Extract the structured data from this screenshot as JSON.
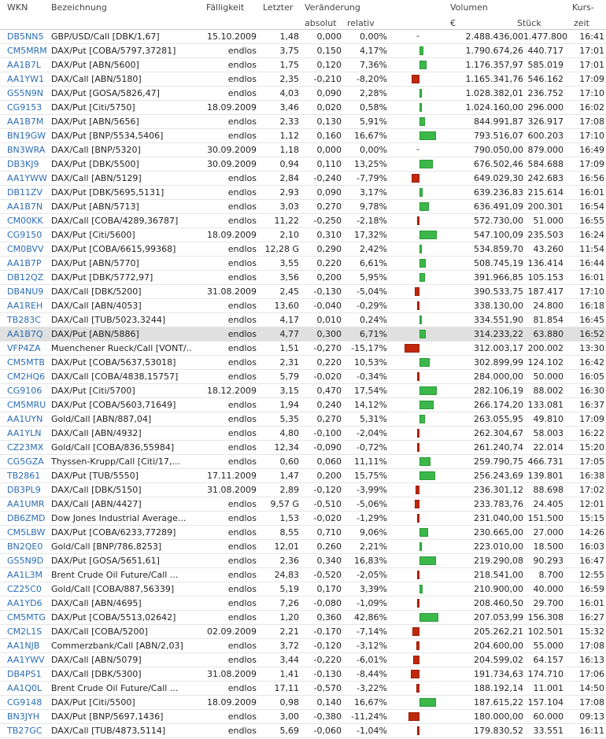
{
  "header": {
    "wkn": "WKN",
    "bezeichnung": "Bezeichnung",
    "faelligkeit": "Fälligkeit",
    "letzter": "Letzter",
    "veraenderung": "Veränderung",
    "absolut": "absolut",
    "relativ": "relativ",
    "volumen": "Volumen",
    "euro": "€",
    "stueck": "Stück",
    "kurs": "Kurs-",
    "zeit": "zeit"
  },
  "colors": {
    "positive": "#3cb84a",
    "negative": "#c0280b",
    "link": "#2b6db3"
  },
  "rows": [
    {
      "wkn": "DB5NN5",
      "name": "GBP/USD/Call [DBK/1,67]",
      "mat": "15.10.2009",
      "last": "1,48",
      "abs": "0,000",
      "rel": "0,00%",
      "vol": "2.488.436,00",
      "qty": "1.477.800",
      "time": "16:41"
    },
    {
      "wkn": "CM5MRM",
      "name": "DAX/Put [COBA/5797,37281]",
      "mat": "endlos",
      "last": "3,75",
      "abs": "0,150",
      "rel": "4,17%",
      "vol": "1.790.674,26",
      "qty": "440.717",
      "time": "17:01"
    },
    {
      "wkn": "AA1B7L",
      "name": "DAX/Put [ABN/5600]",
      "mat": "endlos",
      "last": "1,75",
      "abs": "0,120",
      "rel": "7,36%",
      "vol": "1.176.357,97",
      "qty": "585.019",
      "time": "17:01"
    },
    {
      "wkn": "AA1YW1",
      "name": "DAX/Call [ABN/5180]",
      "mat": "endlos",
      "last": "2,35",
      "abs": "-0,210",
      "rel": "-8,20%",
      "vol": "1.165.341,76",
      "qty": "546.162",
      "time": "17:09"
    },
    {
      "wkn": "GS5N9N",
      "name": "DAX/Put [GOSA/5826,47]",
      "mat": "endlos",
      "last": "4,03",
      "abs": "0,090",
      "rel": "2,28%",
      "vol": "1.028.382,01",
      "qty": "236.752",
      "time": "17:10"
    },
    {
      "wkn": "CG9153",
      "name": "DAX/Put [Citi/5750]",
      "mat": "18.09.2009",
      "last": "3,46",
      "abs": "0,020",
      "rel": "0,58%",
      "vol": "1.024.160,00",
      "qty": "296.000",
      "time": "16:02"
    },
    {
      "wkn": "AA1B7M",
      "name": "DAX/Put [ABN/5656]",
      "mat": "endlos",
      "last": "2,33",
      "abs": "0,130",
      "rel": "5,91%",
      "vol": "844.991,87",
      "qty": "326.917",
      "time": "17:08"
    },
    {
      "wkn": "BN19GW",
      "name": "DAX/Put [BNP/5534,5406]",
      "mat": "endlos",
      "last": "1,12",
      "abs": "0,160",
      "rel": "16,67%",
      "vol": "793.516,07",
      "qty": "600.203",
      "time": "17:10"
    },
    {
      "wkn": "BN3WRA",
      "name": "DAX/Call [BNP/5320]",
      "mat": "30.09.2009",
      "last": "1,18",
      "abs": "0,000",
      "rel": "0,00%",
      "vol": "790.050,00",
      "qty": "879.000",
      "time": "16:49"
    },
    {
      "wkn": "DB3KJ9",
      "name": "DAX/Put [DBK/5500]",
      "mat": "30.09.2009",
      "last": "0,94",
      "abs": "0,110",
      "rel": "13,25%",
      "vol": "676.502,46",
      "qty": "584.688",
      "time": "17:09"
    },
    {
      "wkn": "AA1YWW",
      "name": "DAX/Call [ABN/5129]",
      "mat": "endlos",
      "last": "2,84",
      "abs": "-0,240",
      "rel": "-7,79%",
      "vol": "649.029,30",
      "qty": "242.683",
      "time": "16:56"
    },
    {
      "wkn": "DB11ZV",
      "name": "DAX/Put [DBK/5695,5131]",
      "mat": "endlos",
      "last": "2,93",
      "abs": "0,090",
      "rel": "3,17%",
      "vol": "639.236,83",
      "qty": "215.614",
      "time": "16:01"
    },
    {
      "wkn": "AA1B7N",
      "name": "DAX/Put [ABN/5713]",
      "mat": "endlos",
      "last": "3,03",
      "abs": "0,270",
      "rel": "9,78%",
      "vol": "636.491,09",
      "qty": "200.301",
      "time": "16:54"
    },
    {
      "wkn": "CM00KK",
      "name": "DAX/Call [COBA/4289,36787]",
      "mat": "endlos",
      "last": "11,22",
      "abs": "-0,250",
      "rel": "-2,18%",
      "vol": "572.730,00",
      "qty": "51.000",
      "time": "16:55"
    },
    {
      "wkn": "CG9150",
      "name": "DAX/Put [Citi/5600]",
      "mat": "18.09.2009",
      "last": "2,10",
      "abs": "0,310",
      "rel": "17,32%",
      "vol": "547.100,09",
      "qty": "235.503",
      "time": "16:24"
    },
    {
      "wkn": "CM0BVV",
      "name": "DAX/Put [COBA/6615,99368]",
      "mat": "endlos",
      "last": "12,28 G",
      "abs": "0,290",
      "rel": "2,42%",
      "vol": "534.859,70",
      "qty": "43.260",
      "time": "11:54"
    },
    {
      "wkn": "AA1B7P",
      "name": "DAX/Put [ABN/5770]",
      "mat": "endlos",
      "last": "3,55",
      "abs": "0,220",
      "rel": "6,61%",
      "vol": "508.745,19",
      "qty": "136.414",
      "time": "16:44"
    },
    {
      "wkn": "DB12QZ",
      "name": "DAX/Put [DBK/5772,97]",
      "mat": "endlos",
      "last": "3,56",
      "abs": "0,200",
      "rel": "5,95%",
      "vol": "391.966,85",
      "qty": "105.153",
      "time": "16:01"
    },
    {
      "wkn": "DB4NU9",
      "name": "DAX/Call [DBK/5200]",
      "mat": "31.08.2009",
      "last": "2,45",
      "abs": "-0,130",
      "rel": "-5,04%",
      "vol": "390.533,75",
      "qty": "187.417",
      "time": "17:10"
    },
    {
      "wkn": "AA1REH",
      "name": "DAX/Call [ABN/4053]",
      "mat": "endlos",
      "last": "13,60",
      "abs": "-0,040",
      "rel": "-0,29%",
      "vol": "338.130,00",
      "qty": "24.800",
      "time": "16:18"
    },
    {
      "wkn": "TB283C",
      "name": "DAX/Call [TUB/5023,3244]",
      "mat": "endlos",
      "last": "4,17",
      "abs": "0,010",
      "rel": "0,24%",
      "vol": "334.551,90",
      "qty": "81.854",
      "time": "16:45"
    },
    {
      "wkn": "AA1B7Q",
      "name": "DAX/Put [ABN/5886]",
      "mat": "endlos",
      "last": "4,77",
      "abs": "0,300",
      "rel": "6,71%",
      "vol": "314.233,22",
      "qty": "63.880",
      "time": "16:52",
      "hl": true
    },
    {
      "wkn": "VFP4ZA",
      "name": "Muenchener Rueck/Call [VONT/...",
      "mat": "endlos",
      "last": "1,51",
      "abs": "-0,270",
      "rel": "-15,17%",
      "vol": "312.003,17",
      "qty": "200.002",
      "time": "13:30"
    },
    {
      "wkn": "CM5MTB",
      "name": "DAX/Put [COBA/5637,53018]",
      "mat": "endlos",
      "last": "2,31",
      "abs": "0,220",
      "rel": "10,53%",
      "vol": "302.899,99",
      "qty": "124.102",
      "time": "16:42"
    },
    {
      "wkn": "CM2HQ6",
      "name": "DAX/Call [COBA/4838,15757]",
      "mat": "endlos",
      "last": "5,79",
      "abs": "-0,020",
      "rel": "-0,34%",
      "vol": "284.000,00",
      "qty": "50.000",
      "time": "16:05"
    },
    {
      "wkn": "CG9106",
      "name": "DAX/Put [Citi/5700]",
      "mat": "18.12.2009",
      "last": "3,15",
      "abs": "0,470",
      "rel": "17,54%",
      "vol": "282.106,19",
      "qty": "88.002",
      "time": "16:30"
    },
    {
      "wkn": "CM5MRU",
      "name": "DAX/Put [COBA/5603,71649]",
      "mat": "endlos",
      "last": "1,94",
      "abs": "0,240",
      "rel": "14,12%",
      "vol": "266.174,20",
      "qty": "133.081",
      "time": "16:37"
    },
    {
      "wkn": "AA1UYN",
      "name": "Gold/Call [ABN/887,04]",
      "mat": "endlos",
      "last": "5,35",
      "abs": "0,270",
      "rel": "5,31%",
      "vol": "263.055,95",
      "qty": "49.810",
      "time": "17:09"
    },
    {
      "wkn": "AA1YLN",
      "name": "DAX/Call [ABN/4932]",
      "mat": "endlos",
      "last": "4,80",
      "abs": "-0,100",
      "rel": "-2,04%",
      "vol": "262.304,67",
      "qty": "58.003",
      "time": "16:22"
    },
    {
      "wkn": "CZ23MX",
      "name": "Gold/Call [COBA/836,55984]",
      "mat": "endlos",
      "last": "12,34",
      "abs": "-0,090",
      "rel": "-0,72%",
      "vol": "261.240,74",
      "qty": "22.014",
      "time": "15:20"
    },
    {
      "wkn": "CG5GZA",
      "name": "Thyssen-Krupp/Call [Citi/17,...",
      "mat": "endlos",
      "last": "0,60",
      "abs": "0,060",
      "rel": "11,11%",
      "vol": "259.790,75",
      "qty": "466.731",
      "time": "17:05"
    },
    {
      "wkn": "TB2861",
      "name": "DAX/Put [TUB/5550]",
      "mat": "17.11.2009",
      "last": "1,47",
      "abs": "0,200",
      "rel": "15,75%",
      "vol": "256.243,69",
      "qty": "139.801",
      "time": "16:38"
    },
    {
      "wkn": "DB3PL9",
      "name": "DAX/Call [DBK/5150]",
      "mat": "31.08.2009",
      "last": "2,89",
      "abs": "-0,120",
      "rel": "-3,99%",
      "vol": "236.301,12",
      "qty": "88.698",
      "time": "17:02"
    },
    {
      "wkn": "AA1UMR",
      "name": "DAX/Call [ABN/4427]",
      "mat": "endlos",
      "last": "9,57 G",
      "abs": "-0,510",
      "rel": "-5,06%",
      "vol": "233.783,76",
      "qty": "24.405",
      "time": "12:01"
    },
    {
      "wkn": "DB6ZMD",
      "name": "Dow Jones Industrial Average...",
      "mat": "endlos",
      "last": "1,53",
      "abs": "-0,020",
      "rel": "-1,29%",
      "vol": "231.040,00",
      "qty": "151.500",
      "time": "15:15"
    },
    {
      "wkn": "CM5LBW",
      "name": "DAX/Put [COBA/6233,77289]",
      "mat": "endlos",
      "last": "8,55",
      "abs": "0,710",
      "rel": "9,06%",
      "vol": "230.665,00",
      "qty": "27.000",
      "time": "14:26"
    },
    {
      "wkn": "BN2QE0",
      "name": "Gold/Call [BNP/786,8253]",
      "mat": "endlos",
      "last": "12,01",
      "abs": "0,260",
      "rel": "2,21%",
      "vol": "223.010,00",
      "qty": "18.500",
      "time": "16:03"
    },
    {
      "wkn": "GS5N9D",
      "name": "DAX/Put [GOSA/5651,61]",
      "mat": "endlos",
      "last": "2,36",
      "abs": "0,340",
      "rel": "16,83%",
      "vol": "219.290,08",
      "qty": "90.293",
      "time": "16:47"
    },
    {
      "wkn": "AA1L3M",
      "name": "Brent Crude Oil Future/Call ...",
      "mat": "endlos",
      "last": "24,83",
      "abs": "-0,520",
      "rel": "-2,05%",
      "vol": "218.541,00",
      "qty": "8.700",
      "time": "12:55"
    },
    {
      "wkn": "CZ25C0",
      "name": "Gold/Call [COBA/887,56339]",
      "mat": "endlos",
      "last": "5,19",
      "abs": "0,170",
      "rel": "3,39%",
      "vol": "210.900,00",
      "qty": "40.000",
      "time": "16:59"
    },
    {
      "wkn": "AA1YD6",
      "name": "DAX/Call [ABN/4695]",
      "mat": "endlos",
      "last": "7,26",
      "abs": "-0,080",
      "rel": "-1,09%",
      "vol": "208.460,50",
      "qty": "29.700",
      "time": "16:01"
    },
    {
      "wkn": "CM5MTG",
      "name": "DAX/Put [COBA/5513,02642]",
      "mat": "endlos",
      "last": "1,20",
      "abs": "0,360",
      "rel": "42,86%",
      "vol": "207.053,99",
      "qty": "156.308",
      "time": "16:27"
    },
    {
      "wkn": "CM2L1S",
      "name": "DAX/Call [COBA/5200]",
      "mat": "02.09.2009",
      "last": "2,21",
      "abs": "-0,170",
      "rel": "-7,14%",
      "vol": "205.262,21",
      "qty": "102.501",
      "time": "15:32"
    },
    {
      "wkn": "AA1NJB",
      "name": "Commerzbank/Call [ABN/2,03]",
      "mat": "endlos",
      "last": "3,72",
      "abs": "-0,120",
      "rel": "-3,12%",
      "vol": "204.600,00",
      "qty": "55.000",
      "time": "17:08"
    },
    {
      "wkn": "AA1YWV",
      "name": "DAX/Call [ABN/5079]",
      "mat": "endlos",
      "last": "3,44",
      "abs": "-0,220",
      "rel": "-6,01%",
      "vol": "204.599,02",
      "qty": "64.157",
      "time": "16:13"
    },
    {
      "wkn": "DB4PS1",
      "name": "DAX/Call [DBK/5300]",
      "mat": "31.08.2009",
      "last": "1,41",
      "abs": "-0,130",
      "rel": "-8,44%",
      "vol": "191.734,63",
      "qty": "174.710",
      "time": "17:06"
    },
    {
      "wkn": "AA1Q0L",
      "name": "Brent Crude Oil Future/Call ...",
      "mat": "endlos",
      "last": "17,11",
      "abs": "-0,570",
      "rel": "-3,22%",
      "vol": "188.192,14",
      "qty": "11.001",
      "time": "14:50"
    },
    {
      "wkn": "CG9148",
      "name": "DAX/Put [Citi/5500]",
      "mat": "18.09.2009",
      "last": "0,98",
      "abs": "0,140",
      "rel": "16,67%",
      "vol": "187.615,22",
      "qty": "157.104",
      "time": "17:08"
    },
    {
      "wkn": "BN3JYH",
      "name": "DAX/Put [BNP/5697,1436]",
      "mat": "endlos",
      "last": "3,00",
      "abs": "-0,380",
      "rel": "-11,24%",
      "vol": "180.000,00",
      "qty": "60.000",
      "time": "09:13"
    },
    {
      "wkn": "TB27GC",
      "name": "DAX/Call [TUB/4873,5114]",
      "mat": "endlos",
      "last": "5,69",
      "abs": "-0,060",
      "rel": "-1,04%",
      "vol": "179.830,52",
      "qty": "33.551",
      "time": "16:11"
    }
  ]
}
